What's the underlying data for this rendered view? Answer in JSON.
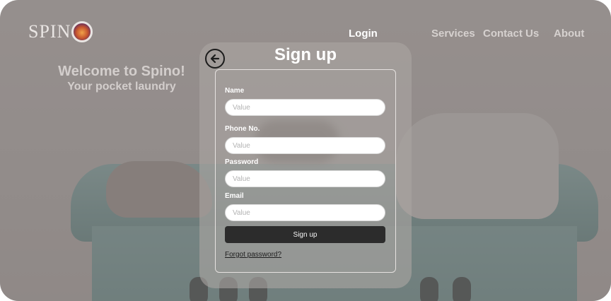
{
  "brand": {
    "name": "SPIN",
    "badge_icon": "spino-logo-badge"
  },
  "nav": {
    "login": "Login",
    "services": "Services",
    "contact": "Contact Us",
    "about": "About"
  },
  "hero": {
    "title": "Welcome to Spino!",
    "subtitle": "Your pocket laundry"
  },
  "signup": {
    "title": "Sign up",
    "back_icon": "arrow-left-circle-icon",
    "fields": {
      "name": {
        "label": "Name",
        "placeholder": "Value"
      },
      "phone": {
        "label": "Phone No.",
        "placeholder": "Value"
      },
      "password": {
        "label": "Password",
        "placeholder": "Value"
      },
      "email": {
        "label": "Email",
        "placeholder": "Value"
      }
    },
    "submit_label": "Sign up",
    "forgot_label": "Forgot password?"
  },
  "colors": {
    "overlay": "#696260",
    "button": "#2c2c2c",
    "accent_text": "#ffffff"
  }
}
